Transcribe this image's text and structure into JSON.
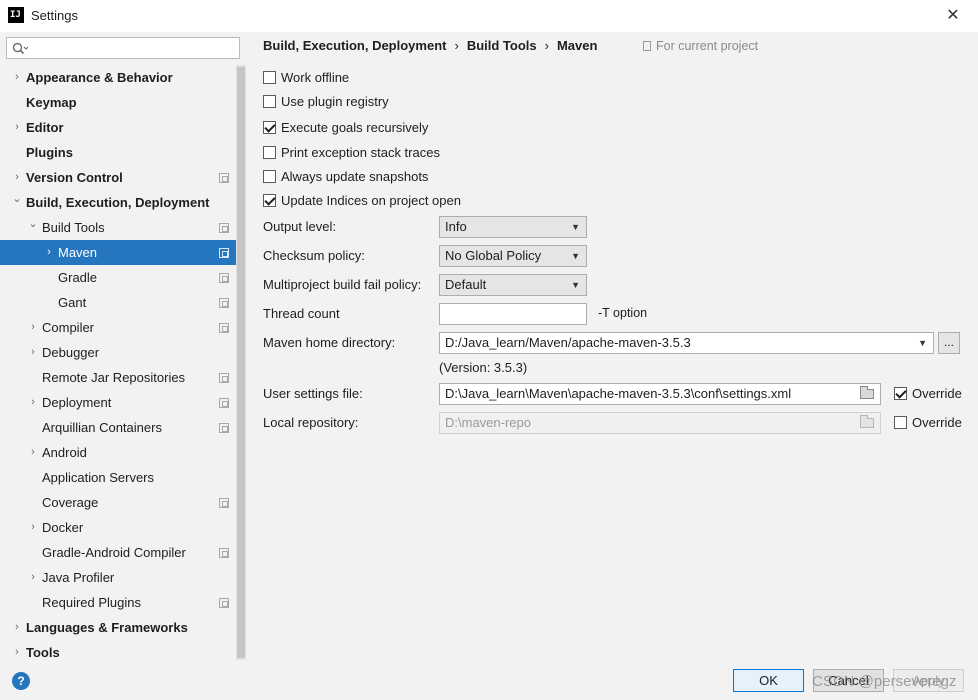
{
  "window": {
    "title": "Settings",
    "app_icon_text": "IJ",
    "close_glyph": "✕"
  },
  "search": {
    "placeholder": ""
  },
  "sidebar": {
    "items": [
      {
        "label": "Appearance & Behavior",
        "level": 0,
        "bold": true,
        "expander": "collapsed",
        "project_icon": false
      },
      {
        "label": "Keymap",
        "level": 0,
        "bold": true,
        "expander": "none",
        "project_icon": false
      },
      {
        "label": "Editor",
        "level": 0,
        "bold": true,
        "expander": "collapsed",
        "project_icon": false
      },
      {
        "label": "Plugins",
        "level": 0,
        "bold": true,
        "expander": "none",
        "project_icon": false
      },
      {
        "label": "Version Control",
        "level": 0,
        "bold": true,
        "expander": "collapsed",
        "project_icon": true
      },
      {
        "label": "Build, Execution, Deployment",
        "level": 0,
        "bold": true,
        "expander": "expanded",
        "project_icon": false
      },
      {
        "label": "Build Tools",
        "level": 1,
        "bold": false,
        "expander": "expanded",
        "project_icon": true
      },
      {
        "label": "Maven",
        "level": 2,
        "bold": false,
        "expander": "collapsed",
        "project_icon": true,
        "selected": true
      },
      {
        "label": "Gradle",
        "level": 2,
        "bold": false,
        "expander": "none",
        "project_icon": true
      },
      {
        "label": "Gant",
        "level": 2,
        "bold": false,
        "expander": "none",
        "project_icon": true
      },
      {
        "label": "Compiler",
        "level": 1,
        "bold": false,
        "expander": "collapsed",
        "project_icon": true
      },
      {
        "label": "Debugger",
        "level": 1,
        "bold": false,
        "expander": "collapsed",
        "project_icon": false
      },
      {
        "label": "Remote Jar Repositories",
        "level": 1,
        "bold": false,
        "expander": "none",
        "project_icon": true
      },
      {
        "label": "Deployment",
        "level": 1,
        "bold": false,
        "expander": "collapsed",
        "project_icon": true
      },
      {
        "label": "Arquillian Containers",
        "level": 1,
        "bold": false,
        "expander": "none",
        "project_icon": true
      },
      {
        "label": "Android",
        "level": 1,
        "bold": false,
        "expander": "collapsed",
        "project_icon": false
      },
      {
        "label": "Application Servers",
        "level": 1,
        "bold": false,
        "expander": "none",
        "project_icon": false
      },
      {
        "label": "Coverage",
        "level": 1,
        "bold": false,
        "expander": "none",
        "project_icon": true
      },
      {
        "label": "Docker",
        "level": 1,
        "bold": false,
        "expander": "collapsed",
        "project_icon": false
      },
      {
        "label": "Gradle-Android Compiler",
        "level": 1,
        "bold": false,
        "expander": "none",
        "project_icon": true
      },
      {
        "label": "Java Profiler",
        "level": 1,
        "bold": false,
        "expander": "collapsed",
        "project_icon": false
      },
      {
        "label": "Required Plugins",
        "level": 1,
        "bold": false,
        "expander": "none",
        "project_icon": true
      },
      {
        "label": "Languages & Frameworks",
        "level": 0,
        "bold": true,
        "expander": "collapsed",
        "project_icon": false
      },
      {
        "label": "Tools",
        "level": 0,
        "bold": true,
        "expander": "collapsed",
        "project_icon": false
      }
    ]
  },
  "breadcrumb": {
    "part1": "Build, Execution, Deployment",
    "part2": "Build Tools",
    "part3": "Maven",
    "separator": "›"
  },
  "scope_label": "For current project",
  "checkboxes": [
    {
      "label": "Work offline",
      "checked": false
    },
    {
      "label": "Use plugin registry",
      "checked": false
    },
    {
      "label": "Execute goals recursively",
      "checked": true
    },
    {
      "label": "Print exception stack traces",
      "checked": false
    },
    {
      "label": "Always update snapshots",
      "checked": false
    },
    {
      "label": "Update Indices on project open",
      "checked": true
    }
  ],
  "fields": {
    "output_level": {
      "label": "Output level:",
      "value": "Info"
    },
    "checksum_policy": {
      "label": "Checksum policy:",
      "value": "No Global Policy"
    },
    "fail_policy": {
      "label": "Multiproject build fail policy:",
      "value": "Default"
    },
    "thread_count": {
      "label": "Thread count",
      "value": "",
      "suffix": "-T option"
    },
    "maven_home": {
      "label": "Maven home directory:",
      "value": "D:/Java_learn/Maven/apache-maven-3.5.3",
      "browse": "...",
      "version": "(Version: 3.5.3)"
    },
    "user_settings": {
      "label": "User settings file:",
      "value": "D:\\Java_learn\\Maven\\apache-maven-3.5.3\\conf\\settings.xml",
      "override_label": "Override",
      "override_checked": true
    },
    "local_repo": {
      "label": "Local repository:",
      "value": "D:\\maven-repo",
      "override_label": "Override",
      "override_checked": false
    }
  },
  "buttons": {
    "ok": "OK",
    "cancel": "Cancel",
    "apply": "Apply",
    "help": "?"
  },
  "watermark": "CSDN @perseveregz",
  "colors": {
    "selection": "#2675bf",
    "background": "#f2f2f2",
    "default_button_border": "#0078d7"
  }
}
